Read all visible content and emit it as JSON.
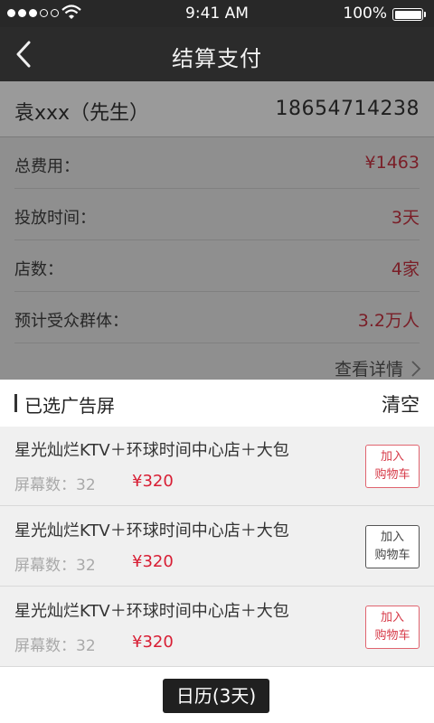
{
  "status_bar": {
    "time": "9:41 AM",
    "battery": "100%"
  },
  "nav": {
    "title": "结算支付",
    "back_icon": "chevron-left-icon"
  },
  "user": {
    "name": "袁xxx（先生）",
    "phone": "18654714238"
  },
  "summary": [
    {
      "label": "总费用：",
      "value": "¥1463"
    },
    {
      "label": "投放时间：",
      "value": "3天"
    },
    {
      "label": "店数：",
      "value": "4家"
    },
    {
      "label": "预计受众群体：",
      "value": "3.2万人"
    }
  ],
  "details_link": "查看详情",
  "selected": {
    "title": "已选广告屏",
    "clear": "清空",
    "items": [
      {
        "name": "星光灿烂KTV＋环球时间中心店＋大包",
        "screens": "屏幕数：32",
        "price": "¥320",
        "cart_line1": "加入",
        "cart_line2": "购物车"
      },
      {
        "name": "星光灿烂KTV＋环球时间中心店＋大包",
        "screens": "屏幕数：32",
        "price": "¥320",
        "cart_line1": "加入",
        "cart_line2": "购物车"
      },
      {
        "name": "星光灿烂KTV＋环球时间中心店＋大包",
        "screens": "屏幕数：32",
        "price": "¥320",
        "cart_line1": "加入",
        "cart_line2": "购物车"
      }
    ]
  },
  "calendar_button": "日历(3天)",
  "colors": {
    "accent_red": "#d81e34",
    "nav_bg": "#2b2b2b"
  }
}
